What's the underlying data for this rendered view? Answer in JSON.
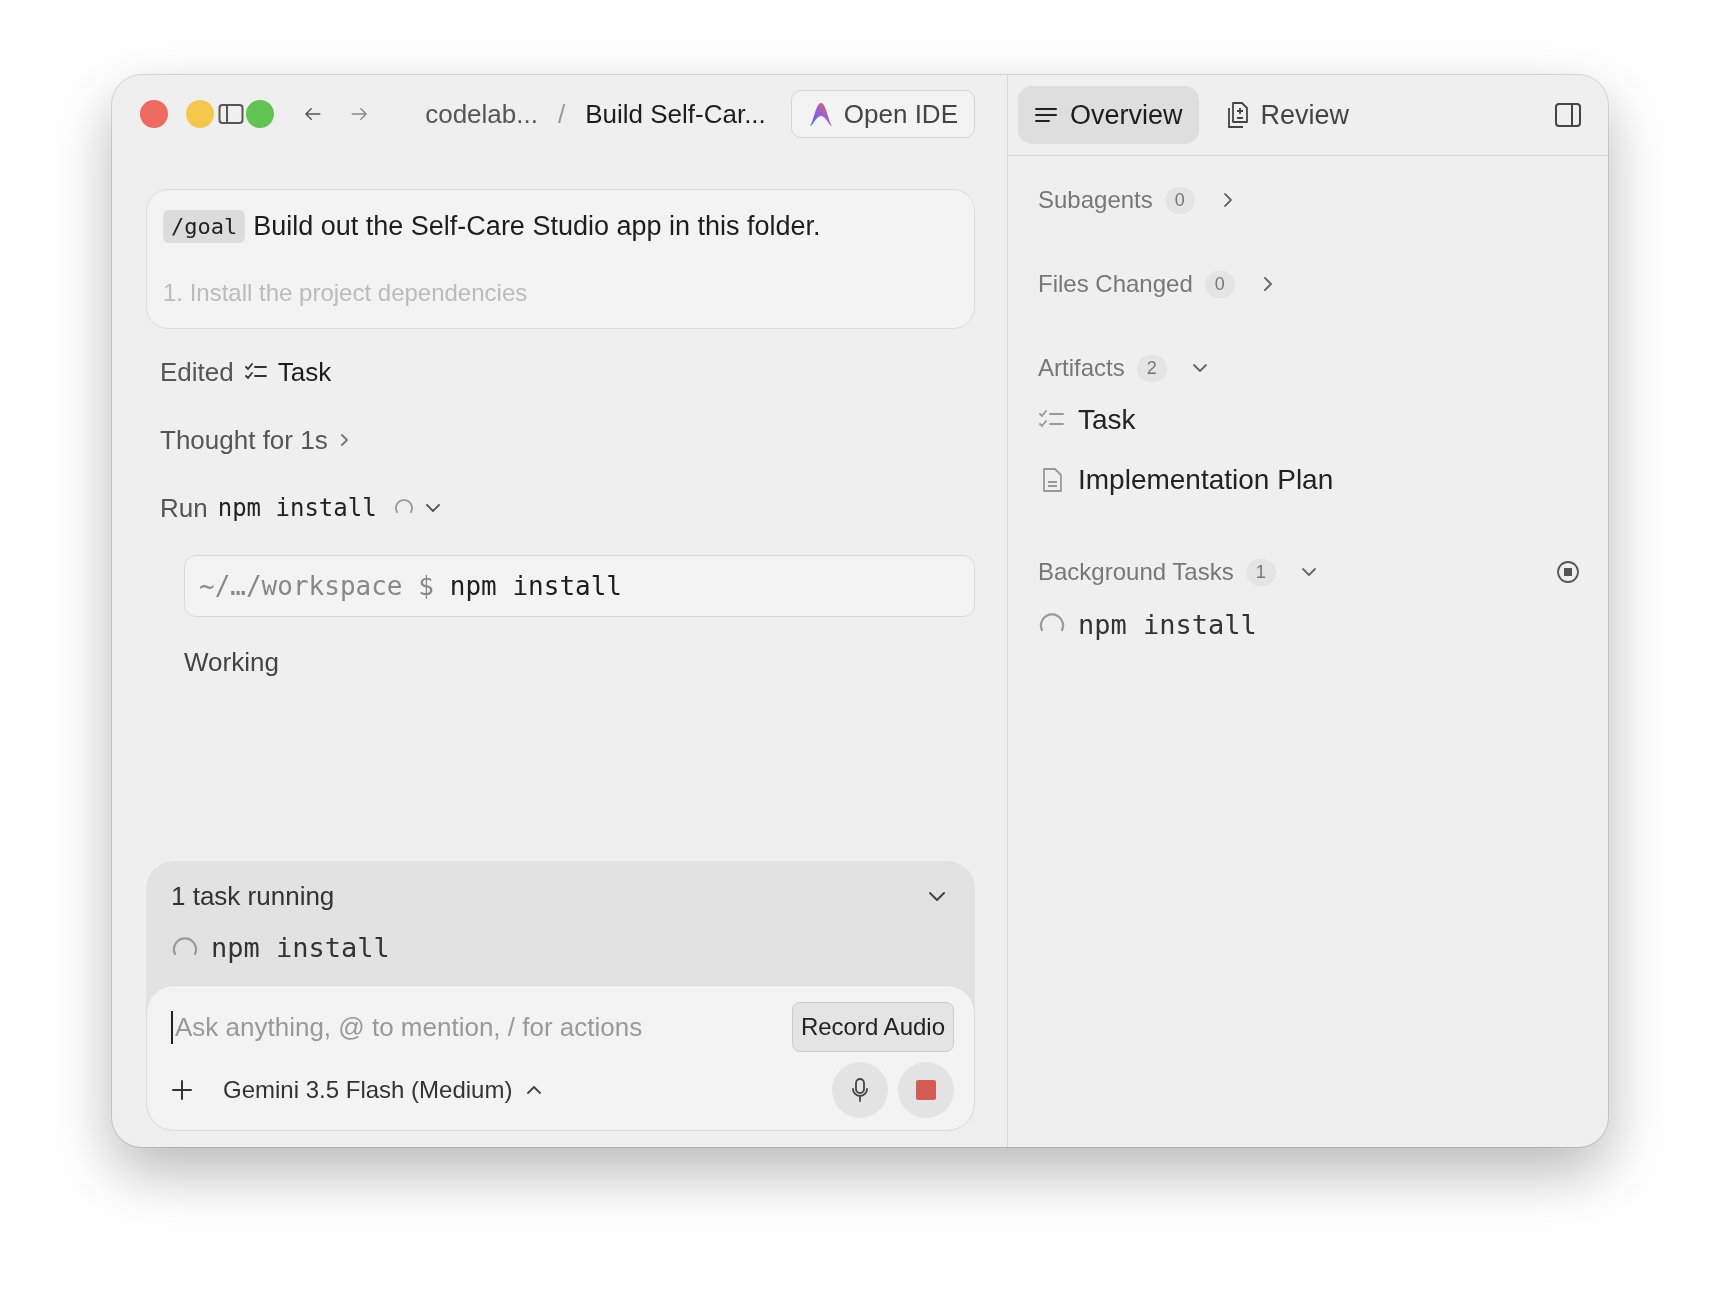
{
  "breadcrumb": {
    "items": [
      "codelab...",
      "Build Self-Car..."
    ],
    "separator": "/"
  },
  "open_ide_button": "Open IDE",
  "tabs": [
    {
      "kind": "overview",
      "label": "Overview",
      "selected": true
    },
    {
      "kind": "review",
      "label": "Review",
      "selected": false
    }
  ],
  "goal": {
    "command": "/goal",
    "text": "Build out the Self-Care Studio app in this folder.",
    "next_line": "1. Install the project dependencies"
  },
  "steps": [
    {
      "kind": "edit",
      "verb": "Edited",
      "target": "Task"
    },
    {
      "kind": "thought",
      "text": "Thought for 1s",
      "expanded": false
    },
    {
      "kind": "run",
      "verb": "Run",
      "command": "npm install",
      "running": true,
      "expanded": true
    }
  ],
  "terminal": {
    "cwd": "~/…/workspace $",
    "command": "npm install"
  },
  "status": "Working",
  "running_tasks": {
    "title": "1 task running",
    "expanded": true,
    "tasks": [
      "npm install"
    ]
  },
  "composer": {
    "placeholder": "Ask anything, @ to mention, / for actions",
    "model": "Gemini 3.5 Flash (Medium)",
    "tooltip": "Record Audio"
  },
  "overview": {
    "sections": [
      {
        "title": "Subagents",
        "count": "0",
        "expanded": false
      },
      {
        "title": "Files Changed",
        "count": "0",
        "expanded": false
      },
      {
        "title": "Artifacts",
        "count": "2",
        "expanded": true,
        "items": [
          {
            "kind": "task",
            "label": "Task"
          },
          {
            "kind": "document",
            "label": "Implementation Plan"
          }
        ]
      },
      {
        "title": "Background Tasks",
        "count": "1",
        "expanded": true,
        "stoppable": true,
        "items": [
          {
            "kind": "process",
            "label": "npm install"
          }
        ]
      }
    ]
  }
}
